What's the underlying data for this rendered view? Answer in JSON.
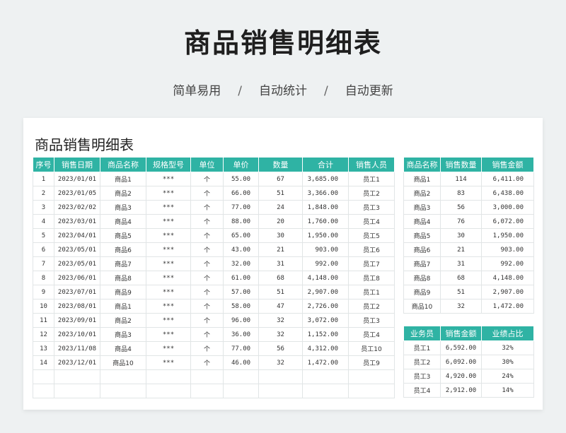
{
  "hero": {
    "title": "商品销售明细表",
    "subtitle_parts": [
      "简单易用",
      "/",
      "自动统计",
      "/",
      "自动更新"
    ]
  },
  "sheet": {
    "title": "商品销售明细表"
  },
  "main_table": {
    "headers": [
      "序号",
      "销售日期",
      "商品名称",
      "规格型号",
      "单位",
      "单价",
      "数量",
      "合计",
      "销售人员"
    ],
    "rows": [
      [
        "1",
        "2023/01/01",
        "商品1",
        "***",
        "个",
        "55.00",
        "67",
        "3,685.00",
        "员工1"
      ],
      [
        "2",
        "2023/01/05",
        "商品2",
        "***",
        "个",
        "66.00",
        "51",
        "3,366.00",
        "员工2"
      ],
      [
        "3",
        "2023/02/02",
        "商品3",
        "***",
        "个",
        "77.00",
        "24",
        "1,848.00",
        "员工3"
      ],
      [
        "4",
        "2023/03/01",
        "商品4",
        "***",
        "个",
        "88.00",
        "20",
        "1,760.00",
        "员工4"
      ],
      [
        "5",
        "2023/04/01",
        "商品5",
        "***",
        "个",
        "65.00",
        "30",
        "1,950.00",
        "员工5"
      ],
      [
        "6",
        "2023/05/01",
        "商品6",
        "***",
        "个",
        "43.00",
        "21",
        "903.00",
        "员工6"
      ],
      [
        "7",
        "2023/05/01",
        "商品7",
        "***",
        "个",
        "32.00",
        "31",
        "992.00",
        "员工7"
      ],
      [
        "8",
        "2023/06/01",
        "商品8",
        "***",
        "个",
        "61.00",
        "68",
        "4,148.00",
        "员工8"
      ],
      [
        "9",
        "2023/07/01",
        "商品9",
        "***",
        "个",
        "57.00",
        "51",
        "2,907.00",
        "员工1"
      ],
      [
        "10",
        "2023/08/01",
        "商品1",
        "***",
        "个",
        "58.00",
        "47",
        "2,726.00",
        "员工2"
      ],
      [
        "11",
        "2023/09/01",
        "商品2",
        "***",
        "个",
        "96.00",
        "32",
        "3,072.00",
        "员工3"
      ],
      [
        "12",
        "2023/10/01",
        "商品3",
        "***",
        "个",
        "36.00",
        "32",
        "1,152.00",
        "员工4"
      ],
      [
        "13",
        "2023/11/08",
        "商品4",
        "***",
        "个",
        "77.00",
        "56",
        "4,312.00",
        "员工10"
      ],
      [
        "14",
        "2023/12/01",
        "商品10",
        "***",
        "个",
        "46.00",
        "32",
        "1,472.00",
        "员工9"
      ],
      [
        "",
        "",
        "",
        "",
        "",
        "",
        "",
        "",
        ""
      ],
      [
        "",
        "",
        "",
        "",
        "",
        "",
        "",
        "",
        ""
      ]
    ]
  },
  "product_summary": {
    "headers": [
      "商品名称",
      "销售数量",
      "销售金额"
    ],
    "rows": [
      [
        "商品1",
        "114",
        "6,411.00"
      ],
      [
        "商品2",
        "83",
        "6,438.00"
      ],
      [
        "商品3",
        "56",
        "3,000.00"
      ],
      [
        "商品4",
        "76",
        "6,072.00"
      ],
      [
        "商品5",
        "30",
        "1,950.00"
      ],
      [
        "商品6",
        "21",
        "903.00"
      ],
      [
        "商品7",
        "31",
        "992.00"
      ],
      [
        "商品8",
        "68",
        "4,148.00"
      ],
      [
        "商品9",
        "51",
        "2,907.00"
      ],
      [
        "商品10",
        "32",
        "1,472.00"
      ]
    ]
  },
  "staff_summary": {
    "headers": [
      "业务员",
      "销售金额",
      "业绩占比"
    ],
    "rows": [
      [
        "员工1",
        "6,592.00",
        "32%"
      ],
      [
        "员工2",
        "6,092.00",
        "30%"
      ],
      [
        "员工3",
        "4,920.00",
        "24%"
      ],
      [
        "员工4",
        "2,912.00",
        "14%"
      ]
    ]
  },
  "colors": {
    "header_bg": "#2fb3a4",
    "page_bg": "#eef1f2"
  }
}
